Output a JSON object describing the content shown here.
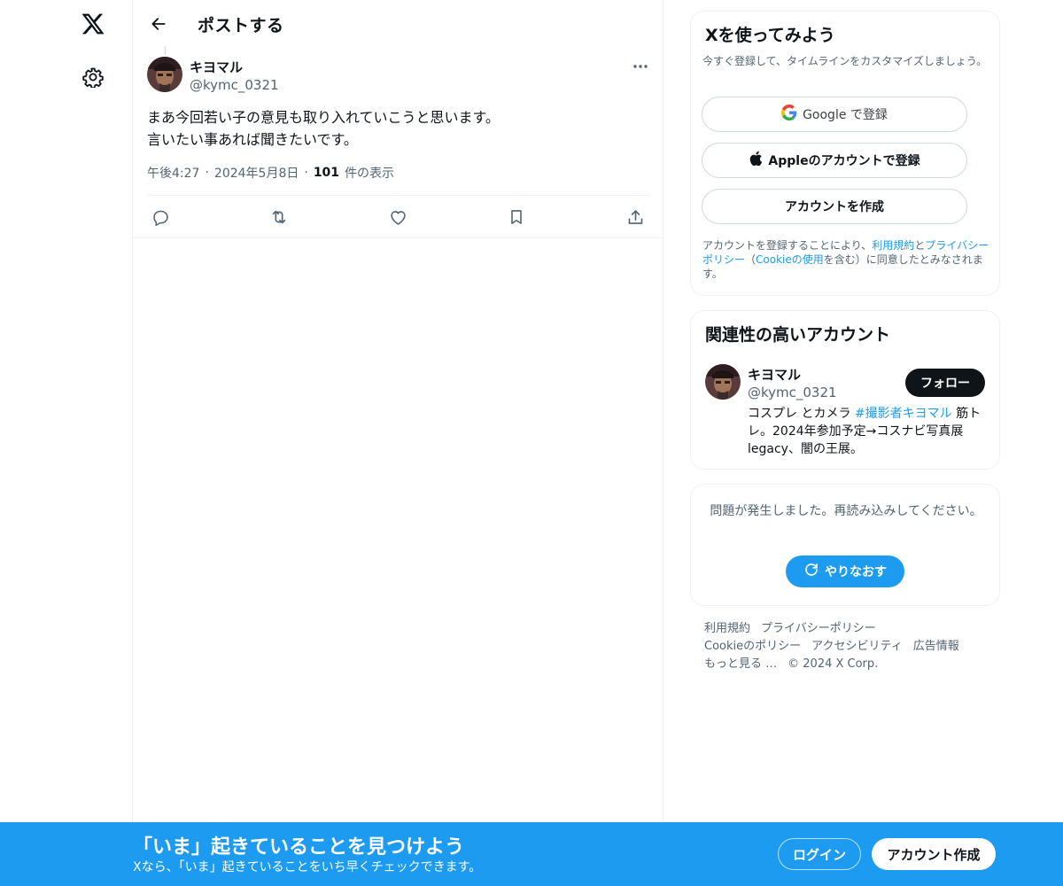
{
  "nav": {
    "logo_icon": "x-logo-icon",
    "settings_icon": "gear-icon"
  },
  "header": {
    "title": "ポストする",
    "back_icon": "arrow-left-icon"
  },
  "post": {
    "author_name": "キヨマル",
    "author_handle": "@kymc_0321",
    "text": "まあ今回若い子の意見も取り入れていこうと思います。\n言いたい事あれば聞きたいです。",
    "time": "午後4:27",
    "date": "2024年5月8日",
    "views_count": "101",
    "views_label": "件の表示",
    "separator": "·",
    "actions": [
      "reply-icon",
      "repost-icon",
      "like-icon",
      "bookmark-icon",
      "share-icon"
    ]
  },
  "signup_card": {
    "title": "Xを使ってみよう",
    "subtitle": "今すぐ登録して、タイムラインをカスタマイズしましょう。",
    "google_label": "Google で登録",
    "apple_label": "Appleのアカウントで登録",
    "create_label": "アカウントを作成",
    "terms_prefix": "アカウントを登録することにより、",
    "terms_link": "利用規約",
    "terms_and": "と",
    "privacy_link": "プライバシーポリシー",
    "terms_paren_open": "（",
    "cookie_link": "Cookieの使用",
    "terms_suffix": "を含む）に同意したとみなされます。"
  },
  "related_card": {
    "title": "関連性の高いアカウント",
    "name": "キヨマル",
    "handle": "@kymc_0321",
    "follow_label": "フォロー",
    "bio_pre": "コスプレ とカメラ ",
    "bio_hashtag": "#撮影者キヨマル",
    "bio_post": " 筋トレ。2024年参加予定→コスナビ写真展legacy、闇の王展。"
  },
  "error_card": {
    "message": "問題が発生しました。再読み込みしてください。",
    "retry_label": "やりなおす"
  },
  "footer": {
    "terms": "利用規約",
    "privacy": "プライバシーポリシー",
    "cookie": "Cookieのポリシー",
    "accessibility": "アクセシビリティ",
    "ads": "広告情報",
    "more": "もっと見る …",
    "copyright": "© 2024 X Corp."
  },
  "banner": {
    "title": "「いま」起きていることを見つけよう",
    "subtitle": "Xなら、「いま」起きていることをいち早くチェックできます。",
    "login_label": "ログイン",
    "signup_label": "アカウント作成"
  },
  "colors": {
    "accent": "#1d9bf0",
    "text": "#0f1419",
    "muted": "#536471",
    "border": "#eff3f4"
  }
}
